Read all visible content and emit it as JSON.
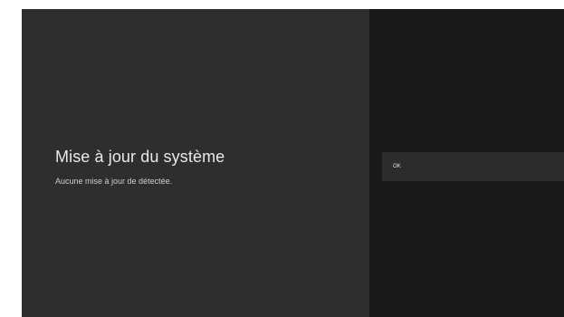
{
  "dialog": {
    "title": "Mise à jour du système",
    "message": "Aucune mise à jour de détectée."
  },
  "actions": {
    "ok_label": "OK"
  },
  "colors": {
    "left_panel_bg": "#2e2e2e",
    "right_panel_bg": "#191919",
    "selected_item_bg": "#2c2c2c",
    "title_text": "#e9e9e9"
  }
}
